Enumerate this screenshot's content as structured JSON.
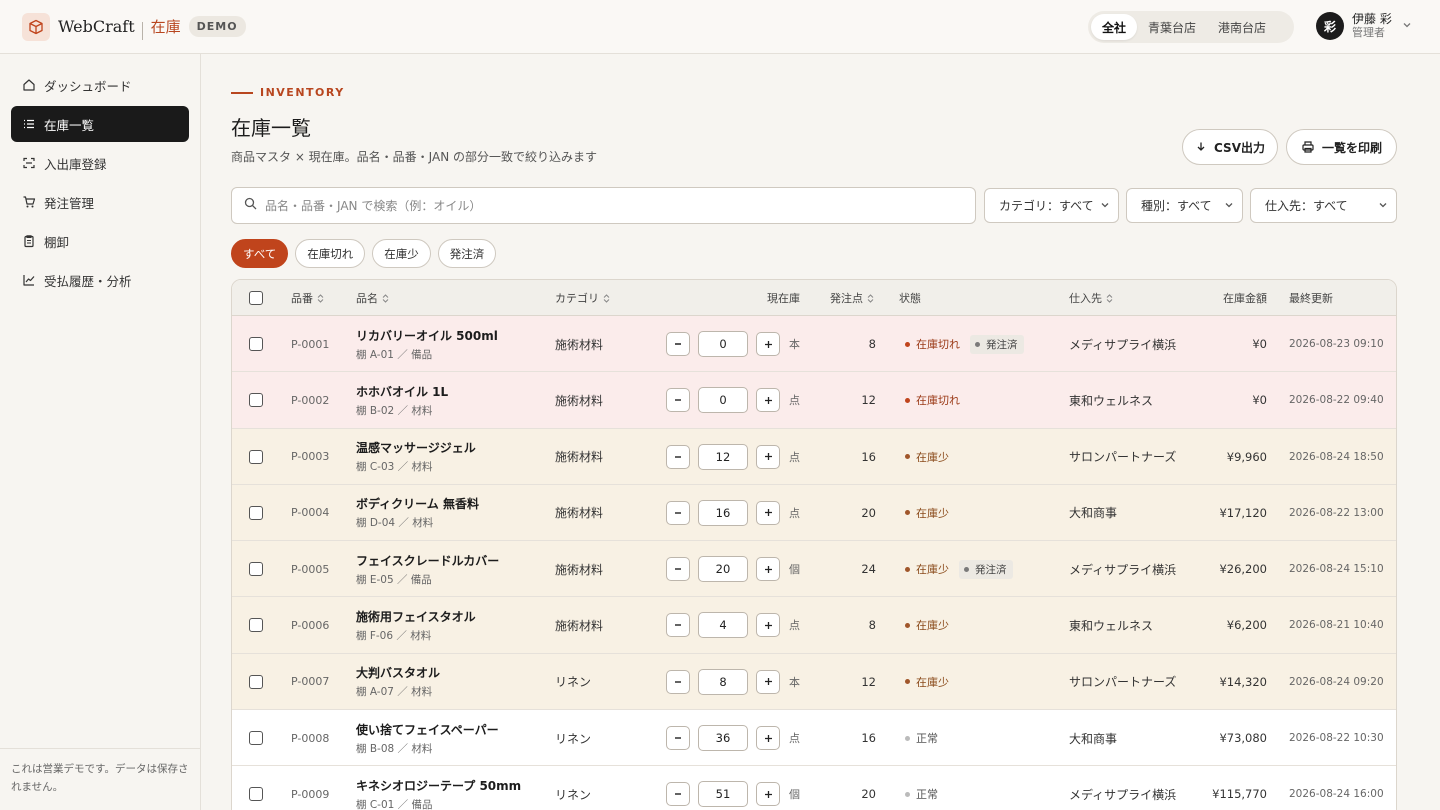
{
  "header": {
    "brand": "WebCraft",
    "brand_sub": "在庫",
    "badge": "DEMO",
    "stores": [
      "全社",
      "青葉台店",
      "港南台店"
    ],
    "active_store": "全社",
    "user": {
      "avatar": "彩",
      "name": "伊藤 彩",
      "role": "管理者"
    }
  },
  "sidebar": {
    "items": [
      {
        "label": "ダッシュボード",
        "icon": "home-icon"
      },
      {
        "label": "在庫一覧",
        "icon": "list-icon"
      },
      {
        "label": "入出庫登録",
        "icon": "transfer-icon"
      },
      {
        "label": "発注管理",
        "icon": "cart-icon"
      },
      {
        "label": "棚卸",
        "icon": "clipboard-icon"
      },
      {
        "label": "受払履歴・分析",
        "icon": "chart-icon"
      }
    ],
    "active_index": 1,
    "footer": "これは営業デモです。データは保存されません。"
  },
  "main": {
    "eyebrow": "INVENTORY",
    "title": "在庫一覧",
    "subtitle": "商品マスタ × 現在庫。品名・品番・JAN の部分一致で絞り込みます",
    "csv_label": "CSV出力",
    "print_label": "一覧を印刷",
    "search_placeholder": "品名・品番・JAN で検索（例：オイル）",
    "filters": {
      "category": "カテゴリ：すべて",
      "type": "種別：すべて",
      "supplier": "仕入先：すべて"
    },
    "chips": [
      "すべて",
      "在庫切れ",
      "在庫少",
      "発注済"
    ],
    "active_chip": 0
  },
  "table": {
    "headers": {
      "code": "品番",
      "name": "品名",
      "category": "カテゴリ",
      "stock": "現在庫",
      "reorder": "発注点",
      "status": "状態",
      "supplier": "仕入先",
      "amount": "在庫金額",
      "updated": "最終更新"
    },
    "ordered_label": "発注済",
    "rows": [
      {
        "code": "P-0001",
        "name": "リカバリーオイル 500ml",
        "loc": "棚 A-01 ／ 備品",
        "category": "施術材料",
        "qty": "0",
        "unit": "本",
        "reorder": "8",
        "status": "在庫切れ",
        "state": "out",
        "ordered": true,
        "supplier": "メディサプライ横浜",
        "amount": "¥0",
        "updated": "2026-08-23 09:10"
      },
      {
        "code": "P-0002",
        "name": "ホホバオイル 1L",
        "loc": "棚 B-02 ／ 材料",
        "category": "施術材料",
        "qty": "0",
        "unit": "点",
        "reorder": "12",
        "status": "在庫切れ",
        "state": "out",
        "ordered": false,
        "supplier": "東和ウェルネス",
        "amount": "¥0",
        "updated": "2026-08-22 09:40"
      },
      {
        "code": "P-0003",
        "name": "温感マッサージジェル",
        "loc": "棚 C-03 ／ 材料",
        "category": "施術材料",
        "qty": "12",
        "unit": "点",
        "reorder": "16",
        "status": "在庫少",
        "state": "low",
        "ordered": false,
        "supplier": "サロンパートナーズ",
        "amount": "¥9,960",
        "updated": "2026-08-24 18:50"
      },
      {
        "code": "P-0004",
        "name": "ボディクリーム 無香料",
        "loc": "棚 D-04 ／ 材料",
        "category": "施術材料",
        "qty": "16",
        "unit": "点",
        "reorder": "20",
        "status": "在庫少",
        "state": "low",
        "ordered": false,
        "supplier": "大和商事",
        "amount": "¥17,120",
        "updated": "2026-08-22 13:00"
      },
      {
        "code": "P-0005",
        "name": "フェイスクレードルカバー",
        "loc": "棚 E-05 ／ 備品",
        "category": "施術材料",
        "qty": "20",
        "unit": "個",
        "reorder": "24",
        "status": "在庫少",
        "state": "low",
        "ordered": true,
        "supplier": "メディサプライ横浜",
        "amount": "¥26,200",
        "updated": "2026-08-24 15:10"
      },
      {
        "code": "P-0006",
        "name": "施術用フェイスタオル",
        "loc": "棚 F-06 ／ 材料",
        "category": "施術材料",
        "qty": "4",
        "unit": "点",
        "reorder": "8",
        "status": "在庫少",
        "state": "low",
        "ordered": false,
        "supplier": "東和ウェルネス",
        "amount": "¥6,200",
        "updated": "2026-08-21 10:40"
      },
      {
        "code": "P-0007",
        "name": "大判バスタオル",
        "loc": "棚 A-07 ／ 材料",
        "category": "リネン",
        "qty": "8",
        "unit": "本",
        "reorder": "12",
        "status": "在庫少",
        "state": "low",
        "ordered": false,
        "supplier": "サロンパートナーズ",
        "amount": "¥14,320",
        "updated": "2026-08-24 09:20"
      },
      {
        "code": "P-0008",
        "name": "使い捨てフェイスペーパー",
        "loc": "棚 B-08 ／ 材料",
        "category": "リネン",
        "qty": "36",
        "unit": "点",
        "reorder": "16",
        "status": "正常",
        "state": "ok",
        "ordered": false,
        "supplier": "大和商事",
        "amount": "¥73,080",
        "updated": "2026-08-22 10:30"
      },
      {
        "code": "P-0009",
        "name": "キネシオロジーテープ 50mm",
        "loc": "棚 C-01 ／ 備品",
        "category": "リネン",
        "qty": "51",
        "unit": "個",
        "reorder": "20",
        "status": "正常",
        "state": "ok",
        "ordered": false,
        "supplier": "メディサプライ横浜",
        "amount": "¥115,770",
        "updated": "2026-08-24 16:00"
      }
    ]
  },
  "colors": {
    "accent": "#c0441c",
    "out_bg": "#fbeceb",
    "low_bg": "#f8f1e4",
    "out_dot": "#c0441c",
    "low_dot": "#a0562a",
    "ok_dot": "#bbbbbb"
  }
}
